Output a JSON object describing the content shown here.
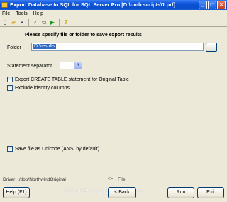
{
  "window": {
    "title": "Export Database to SQL for SQL Server Pro [D:\\omb scripts\\1.prf]",
    "min_glyph": "_",
    "max_glyph": "□",
    "close_glyph": "×"
  },
  "menu": [
    "File",
    "Tools",
    "Help"
  ],
  "toolbar": {
    "icons": [
      "new-icon",
      "open-icon",
      "save-icon",
      "settings-icon",
      "copy-icon",
      "run-icon",
      "help-icon"
    ],
    "glyphs": [
      "▯",
      "▰",
      "▪",
      "✓",
      "⧉",
      "▶",
      "?"
    ]
  },
  "form": {
    "heading": "Please specify file or folder to save export results",
    "folder_label": "Folder",
    "folder_value": "D:\\results",
    "browse_label": "...",
    "separator_label": "Statement separator",
    "separator_arrow": "▼",
    "chk_create_table": "Export CREATE TABLE statement for Original Table",
    "chk_exclude_identity": "Exclude identity columns",
    "chk_unicode": "Save file as Unicode (ANSI by default)"
  },
  "status": {
    "left": "Driver: ./dbo/NorthwindOriginal",
    "sep": "<=",
    "right": "File"
  },
  "buttons": {
    "help": "Help (F1)",
    "back": "< Back",
    "run": "Run",
    "exit": "Exit"
  },
  "watermark": "GearDownload.com"
}
